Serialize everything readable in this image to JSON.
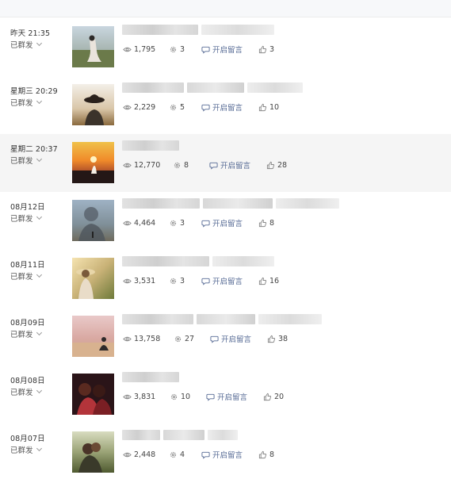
{
  "colors": {
    "accent": "#576b95",
    "highlight_row": "#f5f5f5"
  },
  "icons": {
    "views": "eye-icon",
    "shares": "gear-icon",
    "comments": "speech-bubble-icon",
    "likes": "thumbs-up-icon",
    "status": "chevron-down-icon"
  },
  "articles": [
    {
      "date": "昨天 21:35",
      "status": "已群发",
      "views": "1,795",
      "shares": "3",
      "comment_label": "开启留言",
      "likes": "3"
    },
    {
      "date": "星期三 20:29",
      "status": "已群发",
      "views": "2,229",
      "shares": "5",
      "comment_label": "开启留言",
      "likes": "10"
    },
    {
      "date": "星期二 20:37",
      "status": "已群发",
      "views": "12,770",
      "shares": "8",
      "comment_label": "开启留言",
      "likes": "28"
    },
    {
      "date": "08月12日",
      "status": "已群发",
      "views": "4,464",
      "shares": "3",
      "comment_label": "开启留言",
      "likes": "8"
    },
    {
      "date": "08月11日",
      "status": "已群发",
      "views": "3,531",
      "shares": "3",
      "comment_label": "开启留言",
      "likes": "16"
    },
    {
      "date": "08月09日",
      "status": "已群发",
      "views": "13,758",
      "shares": "27",
      "comment_label": "开启留言",
      "likes": "38"
    },
    {
      "date": "08月08日",
      "status": "已群发",
      "views": "3,831",
      "shares": "10",
      "comment_label": "开启留言",
      "likes": "20"
    },
    {
      "date": "08月07日",
      "status": "已群发",
      "views": "2,448",
      "shares": "4",
      "comment_label": "开启留言",
      "likes": "8"
    }
  ]
}
